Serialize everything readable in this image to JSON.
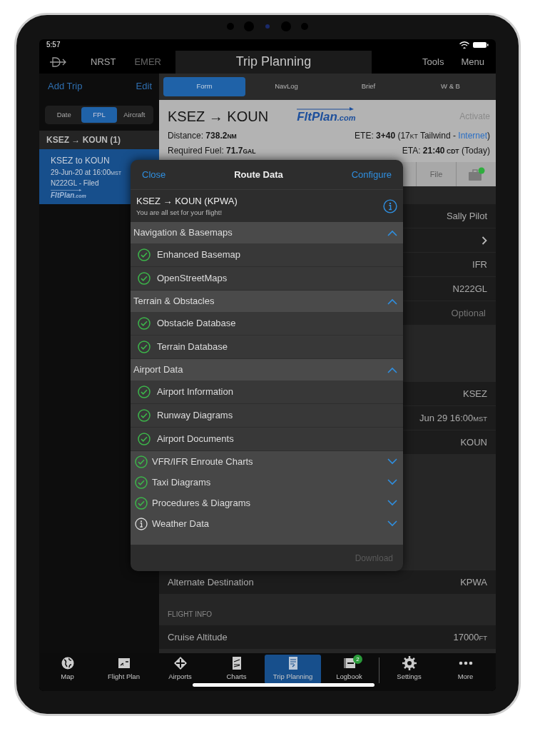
{
  "status_bar": {
    "time": "5:57"
  },
  "top_nav": {
    "left": [
      {
        "label": "NRST",
        "disabled": false
      },
      {
        "label": "EMER",
        "disabled": true
      }
    ],
    "title": "Trip Planning",
    "right": [
      {
        "label": "Tools"
      },
      {
        "label": "Menu"
      }
    ]
  },
  "sidebar": {
    "add": "Add Trip",
    "edit": "Edit",
    "segments": [
      {
        "label": "Date",
        "selected": false
      },
      {
        "label": "FPL",
        "selected": true
      },
      {
        "label": "Aircraft",
        "selected": false
      }
    ],
    "group": "KSEZ → KOUN (1)",
    "trips": [
      {
        "title": "KSEZ to KOUN",
        "date": [
          {
            "text": "29-Jun-20 at 16:00",
            "kind": "plain"
          },
          {
            "text": "MST",
            "kind": "unit"
          }
        ],
        "status": "N222GL - Filed",
        "logo": {
          "name": "FltPlan",
          "suffix": ".com"
        },
        "selected": true
      }
    ]
  },
  "tabs": [
    {
      "label": "Form",
      "selected": true
    },
    {
      "label": "NavLog",
      "selected": false
    },
    {
      "label": "Brief",
      "selected": false
    },
    {
      "label": "W & B",
      "selected": false
    }
  ],
  "summary": {
    "title": "KSEZ → KOUN",
    "logo": {
      "name": "FltPlan",
      "suffix": ".com"
    },
    "activate": "Activate",
    "distance": [
      {
        "text": "Distance: ",
        "kind": "plain"
      },
      {
        "text": "738.2",
        "kind": "bold"
      },
      {
        "text": "NM",
        "kind": "boldunit"
      }
    ],
    "ete": [
      {
        "text": "ETE: ",
        "kind": "plain"
      },
      {
        "text": "3+40",
        "kind": "bold"
      },
      {
        "text": " (17",
        "kind": "plain"
      },
      {
        "text": "KT",
        "kind": "unit"
      },
      {
        "text": " Tailwind - ",
        "kind": "plain"
      },
      {
        "text": "Internet",
        "kind": "link"
      },
      {
        "text": ")",
        "kind": "plain"
      }
    ],
    "fuel": [
      {
        "text": "Required Fuel: ",
        "kind": "plain"
      },
      {
        "text": "71.7",
        "kind": "bold"
      },
      {
        "text": "GAL",
        "kind": "boldunit"
      }
    ],
    "eta": [
      {
        "text": "ETA: ",
        "kind": "plain"
      },
      {
        "text": "21:40",
        "kind": "bold"
      },
      {
        "text": " CDT",
        "kind": "boldunit"
      },
      {
        "text": " (Today)",
        "kind": "plain"
      }
    ]
  },
  "actions": [
    {
      "kind": "text",
      "label": "File",
      "disabled": true
    },
    {
      "kind": "icon",
      "ready": true
    }
  ],
  "form": {
    "groups": [
      {
        "rows": [
          {
            "kind": "value",
            "value": "Sally Pilot"
          },
          {
            "kind": "chevron"
          },
          {
            "kind": "value",
            "value": "IFR"
          },
          {
            "kind": "value",
            "value": "N222GL"
          },
          {
            "kind": "field",
            "placeholder": "Optional"
          }
        ]
      },
      {
        "rows": [
          {
            "kind": "value",
            "value": "KSEZ"
          },
          {
            "kind": "value",
            "value": "Jun 29 16:00",
            "unit": "MST"
          },
          {
            "kind": "value",
            "value": "KOUN"
          },
          {
            "kind": "value",
            "label": "Alternate Destination",
            "value": "KPWA"
          }
        ]
      },
      {
        "header": "FLIGHT INFO",
        "rows": [
          {
            "kind": "value",
            "label": "Cruise Altitude",
            "value": "17000",
            "unit": "FT"
          }
        ]
      }
    ]
  },
  "modal": {
    "close": "Close",
    "title": "Route Data",
    "configure": "Configure",
    "route": "KSEZ → KOUN (KPWA)",
    "message": "You are all set for your flight!",
    "sections": [
      {
        "title": "Navigation & Basemaps",
        "expanded": true,
        "items": [
          {
            "label": "Enhanced Basemap",
            "kind": "ok"
          },
          {
            "label": "OpenStreetMaps",
            "kind": "ok"
          }
        ]
      },
      {
        "title": "Terrain & Obstacles",
        "expanded": true,
        "items": [
          {
            "label": "Obstacle Database",
            "kind": "ok"
          },
          {
            "label": "Terrain Database",
            "kind": "ok"
          }
        ]
      },
      {
        "title": "Airport Data",
        "expanded": true,
        "items": [
          {
            "label": "Airport Information",
            "kind": "ok"
          },
          {
            "label": "Runway Diagrams",
            "kind": "ok"
          },
          {
            "label": "Airport Documents",
            "kind": "ok"
          }
        ]
      },
      {
        "title": "VFR/IFR Enroute Charts",
        "expanded": false,
        "kind": "ok"
      },
      {
        "title": "Taxi Diagrams",
        "expanded": false,
        "kind": "ok"
      },
      {
        "title": "Procedures & Diagrams",
        "expanded": false,
        "kind": "ok"
      },
      {
        "title": "Weather Data",
        "expanded": false,
        "kind": "info"
      }
    ],
    "download": {
      "label": "Download",
      "disabled": true
    }
  },
  "bottom_bar": {
    "main": [
      {
        "label": "Map",
        "selected": false
      },
      {
        "label": "Flight Plan",
        "selected": false
      },
      {
        "label": "Airports",
        "selected": false
      },
      {
        "label": "Charts",
        "selected": false
      },
      {
        "label": "Trip Planning",
        "selected": true
      },
      {
        "label": "Logbook",
        "selected": false,
        "badge": "2"
      }
    ],
    "utility": [
      {
        "label": "Settings",
        "selected": false
      },
      {
        "label": "More",
        "selected": false
      }
    ]
  }
}
